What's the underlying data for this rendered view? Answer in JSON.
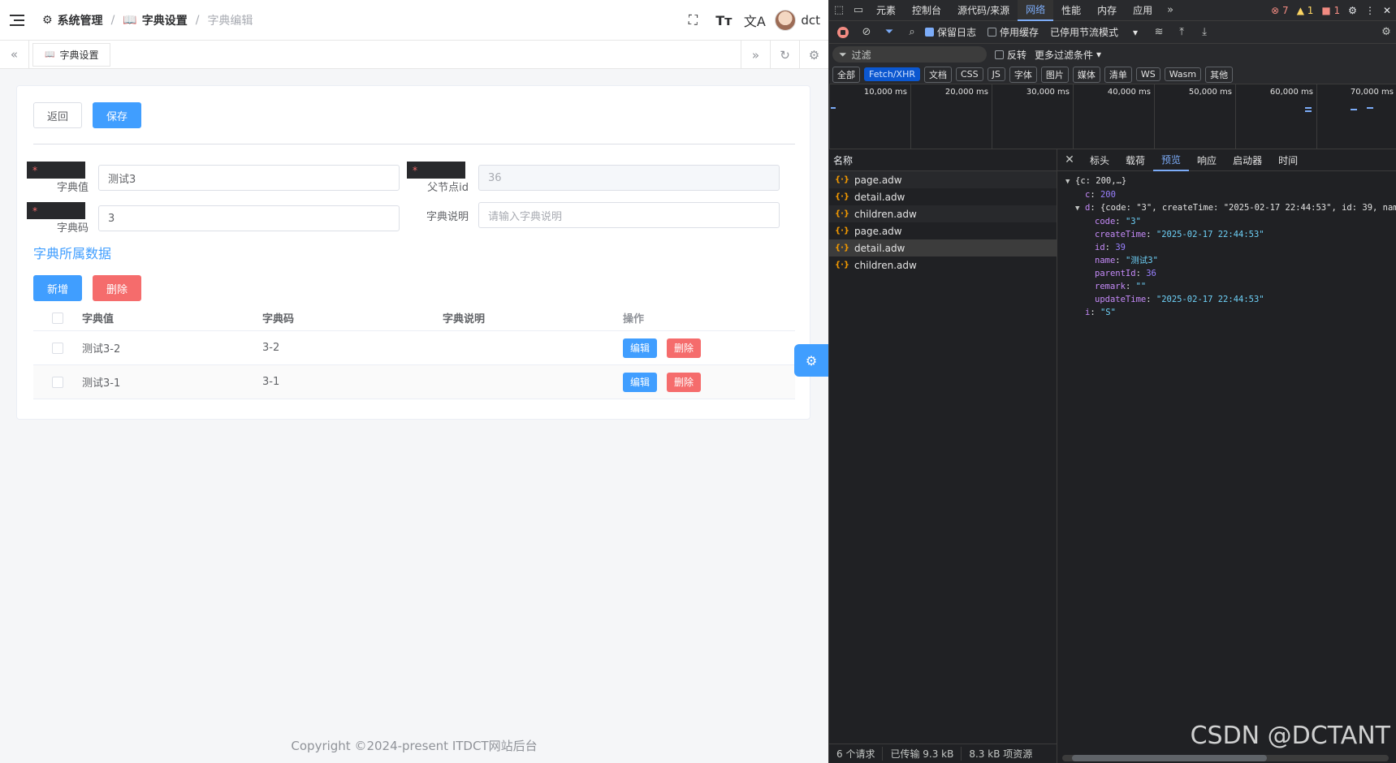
{
  "header": {
    "breadcrumb": [
      "系统管理",
      "字典设置",
      "字典编辑"
    ],
    "user": "dct"
  },
  "tabs": {
    "active": "字典设置"
  },
  "form": {
    "back_label": "返回",
    "save_label": "保存",
    "fields": {
      "dict_value": {
        "label": "字典值",
        "value": "测试3"
      },
      "parent_id": {
        "label": "父节点id",
        "value": "36"
      },
      "dict_code": {
        "label": "字典码",
        "value": "3"
      },
      "dict_desc": {
        "label": "字典说明",
        "placeholder": "请输入字典说明"
      }
    }
  },
  "section_title": "字典所属数据",
  "actions": {
    "add": "新增",
    "delete": "删除"
  },
  "table": {
    "columns": [
      "字典值",
      "字典码",
      "字典说明",
      "操作"
    ],
    "rows": [
      {
        "value": "测试3-2",
        "code": "3-2",
        "desc": ""
      },
      {
        "value": "测试3-1",
        "code": "3-1",
        "desc": ""
      }
    ],
    "edit_label": "编辑",
    "delete_label": "删除"
  },
  "footer": "Copyright ©2024-present ITDCT网站后台",
  "devtools": {
    "tabs": [
      "元素",
      "控制台",
      "源代码/来源",
      "网络",
      "性能",
      "内存",
      "应用"
    ],
    "active_tab": "网络",
    "errors": "7",
    "warnings": "1",
    "issues": "1",
    "preserve_log": "保留日志",
    "disable_cache": "停用缓存",
    "throttle": "已停用节流模式",
    "filter_placeholder": "过滤",
    "invert": "反转",
    "more_filters": "更多过滤条件",
    "type_filters": [
      "全部",
      "Fetch/XHR",
      "文档",
      "CSS",
      "JS",
      "字体",
      "图片",
      "媒体",
      "清单",
      "WS",
      "Wasm",
      "其他"
    ],
    "active_filter": "Fetch/XHR",
    "timeline_ticks": [
      "10,000 ms",
      "20,000 ms",
      "30,000 ms",
      "40,000 ms",
      "50,000 ms",
      "60,000 ms",
      "70,000 ms"
    ],
    "name_header": "名称",
    "requests": [
      "page.adw",
      "detail.adw",
      "children.adw",
      "page.adw",
      "detail.adw",
      "children.adw"
    ],
    "selected_request": 4,
    "detail_tabs": [
      "标头",
      "载荷",
      "预览",
      "响应",
      "启动器",
      "时间"
    ],
    "active_detail_tab": "预览",
    "json": {
      "root": "{c: 200,…}",
      "c": "200",
      "d_summary": "{code: \"3\", createTime: \"2025-02-17 22:44:53\", id: 39, name:",
      "code": "\"3\"",
      "createTime": "\"2025-02-17 22:44:53\"",
      "id": "39",
      "name": "\"测试3\"",
      "parentId": "36",
      "remark": "\"\"",
      "updateTime": "\"2025-02-17 22:44:53\"",
      "i": "\"S\""
    },
    "status": {
      "count": "6 个请求",
      "transferred": "已传输 9.3 kB",
      "resources": "8.3 kB 项资源"
    }
  },
  "watermark": "CSDN @DCTANT"
}
